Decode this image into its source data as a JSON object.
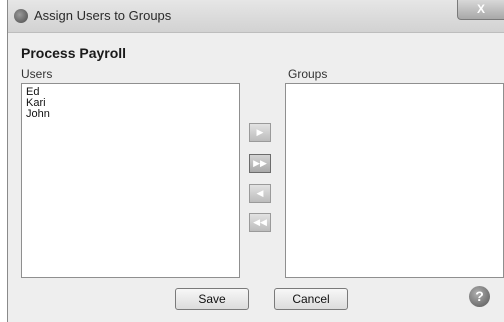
{
  "window": {
    "title": "Assign Users to Groups",
    "close_label": "X"
  },
  "heading": "Process Payroll",
  "users": {
    "label": "Users",
    "items": [
      "Ed",
      "Kari",
      "John"
    ]
  },
  "groups": {
    "label": "Groups",
    "items": []
  },
  "move_buttons": {
    "add": "▶",
    "add_all": "▶▶",
    "remove": "◀",
    "remove_all": "◀◀"
  },
  "buttons": {
    "save": "Save",
    "cancel": "Cancel",
    "help": "?"
  },
  "icons": {
    "app": "app-icon",
    "help": "help-icon"
  }
}
